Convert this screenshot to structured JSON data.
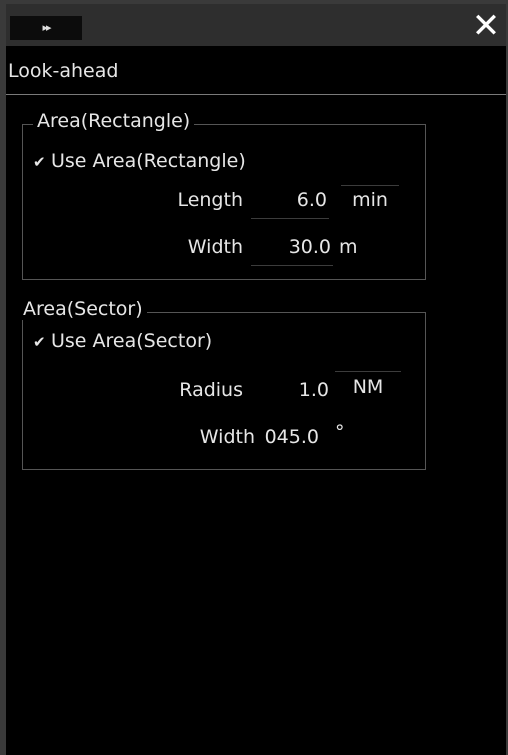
{
  "titlebar": {
    "collapse_glyph": "▸▸",
    "close_glyph": "✕"
  },
  "header": {
    "title": "Look-ahead"
  },
  "rectangle": {
    "legend": "Area(Rectangle)",
    "checkbox_label": "Use Area(Rectangle)",
    "checked": true,
    "length_label": "Length",
    "length_value": "6.0",
    "length_unit": "min",
    "width_label": "Width",
    "width_value": "30.0",
    "width_unit": "m"
  },
  "sector": {
    "legend": "Area(Sector)",
    "checkbox_label": "Use Area(Sector)",
    "checked": true,
    "radius_label": "Radius",
    "radius_value": "1.0",
    "radius_unit": "NM",
    "width_label": "Width",
    "width_value": "045.0",
    "width_unit": "°"
  },
  "icons": {
    "check": "✔"
  }
}
